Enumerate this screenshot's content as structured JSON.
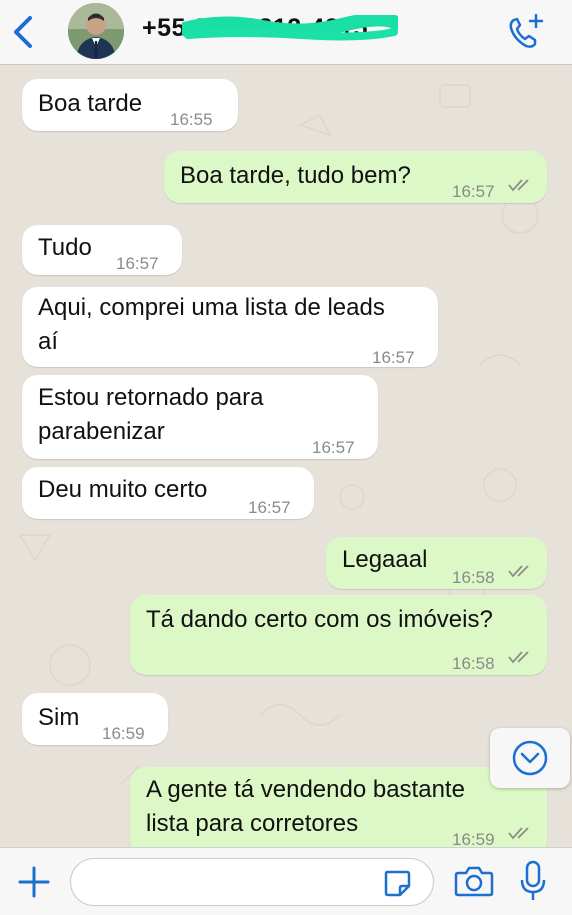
{
  "header": {
    "contact": "+55 21 99812-4215",
    "back_icon": "chevron-left-icon",
    "call_icon": "phone-add-icon",
    "accent": "#1c6fd1"
  },
  "messages": [
    {
      "dir": "in",
      "text": [
        "Boa tarde"
      ],
      "time": "16:55"
    },
    {
      "dir": "out",
      "text": [
        "Boa tarde, tudo bem?"
      ],
      "time": "16:57"
    },
    {
      "dir": "in",
      "text": [
        "Tudo"
      ],
      "time": "16:57"
    },
    {
      "dir": "in",
      "text": [
        "Aqui, comprei uma lista de leads",
        "aí"
      ],
      "time": "16:57"
    },
    {
      "dir": "in",
      "text": [
        "Estou retornado para",
        "parabenizar"
      ],
      "time": "16:57"
    },
    {
      "dir": "in",
      "text": [
        "Deu muito certo"
      ],
      "time": "16:57"
    },
    {
      "dir": "out",
      "text": [
        "Legaaal"
      ],
      "time": "16:58"
    },
    {
      "dir": "out",
      "text": [
        "Tá dando certo com os imóveis?"
      ],
      "time": "16:58"
    },
    {
      "dir": "in",
      "text": [
        "Sim"
      ],
      "time": "16:59"
    },
    {
      "dir": "out",
      "text": [
        "A gente tá vendendo bastante",
        "lista para corretores"
      ],
      "time": "16:59"
    }
  ],
  "colors": {
    "incoming": "#ffffff",
    "outgoing": "#dcf8c6",
    "chat_bg": "#e6e2da",
    "time": "#8b8b8b"
  },
  "input": {
    "value": "",
    "placeholder": ""
  },
  "icons": {
    "plus": "plus-icon",
    "sticker": "sticker-icon",
    "camera": "camera-icon",
    "mic": "microphone-icon",
    "scroll": "chevron-down-circle-icon",
    "ticks": "double-check-icon"
  }
}
